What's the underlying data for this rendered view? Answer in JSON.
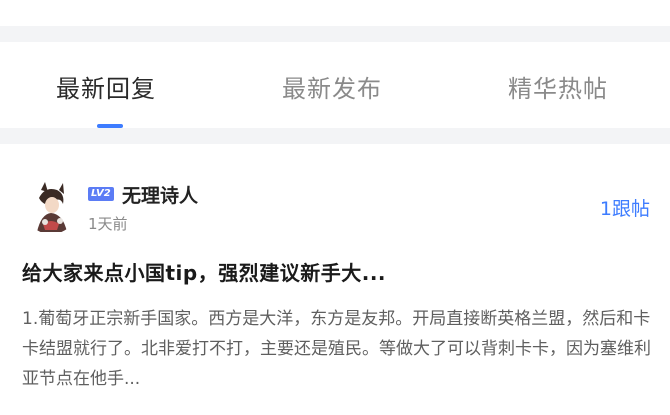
{
  "tabs": [
    {
      "label": "最新回复",
      "active": true
    },
    {
      "label": "最新发布",
      "active": false
    },
    {
      "label": "精华热帖",
      "active": false
    }
  ],
  "colors": {
    "accent": "#3d7cff",
    "badge": "#5b7cf5",
    "separator": "#f3f4f6"
  },
  "post": {
    "avatar_icon": "anime-character-avatar",
    "level_badge": "LV2",
    "username": "无理诗人",
    "timestamp": "1天前",
    "reply_count": "1跟帖",
    "title": "给大家来点小国tip，强烈建议新手大...",
    "body": "1.葡萄牙正宗新手国家。西方是大洋，东方是友邦。开局直接断英格兰盟，然后和卡卡结盟就行了。北非爱打不打，主要还是殖民。等做大了可以背刺卡卡，因为塞维利亚节点在他手..."
  }
}
